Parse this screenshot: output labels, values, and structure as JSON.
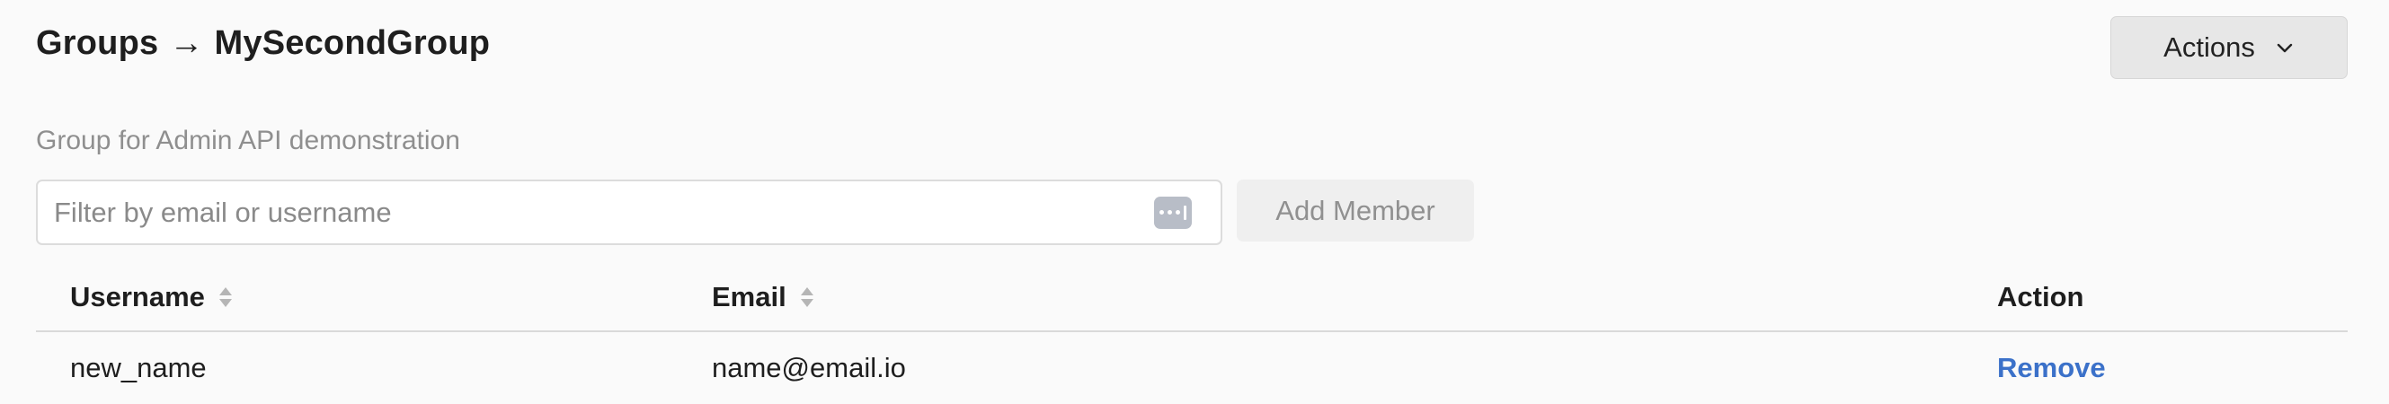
{
  "header": {
    "breadcrumb_parent": "Groups",
    "breadcrumb_separator": "→",
    "group_name": "MySecondGroup",
    "actions_label": "Actions"
  },
  "group": {
    "description": "Group for Admin API demonstration"
  },
  "filter": {
    "placeholder": "Filter by email or username",
    "value": ""
  },
  "add_member_label": "Add Member",
  "table": {
    "columns": [
      {
        "label": "Username",
        "sortable": true
      },
      {
        "label": "Email",
        "sortable": true
      },
      {
        "label": "Action",
        "sortable": false
      }
    ],
    "rows": [
      {
        "username": "new_name",
        "email": "name@email.io",
        "action": "Remove"
      }
    ]
  },
  "icons": {
    "actions": "chevron-down-icon",
    "filter_field": "password-manager-icon",
    "sort": "sort-icon"
  },
  "colors": {
    "link": "#3b71c9",
    "muted_text": "#8f8f8f",
    "button_bg": "#e7e7e7"
  }
}
